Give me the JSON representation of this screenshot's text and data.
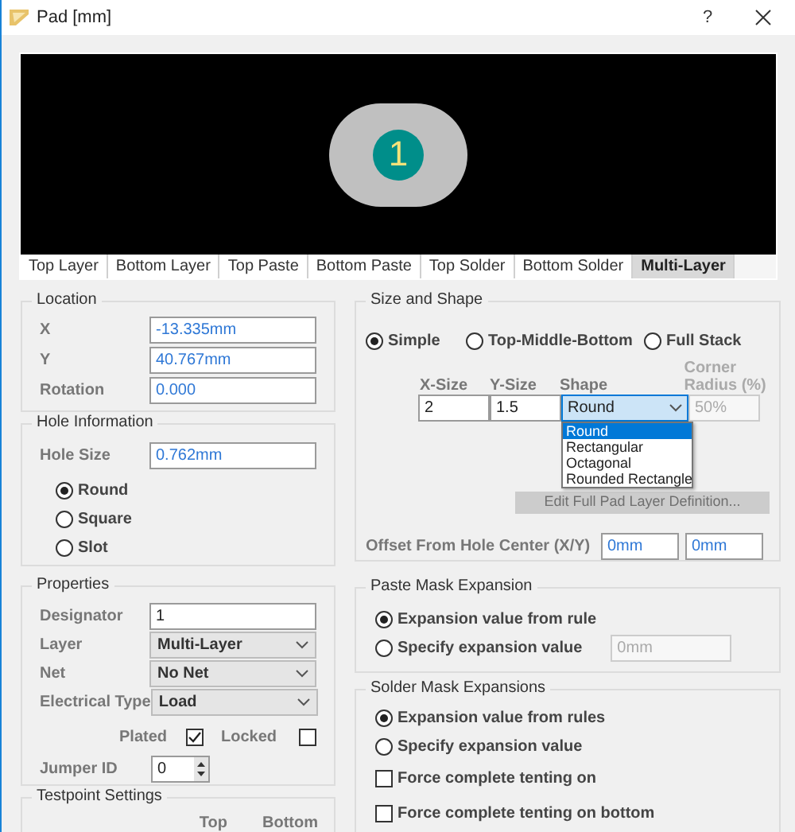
{
  "window": {
    "title": "Pad [mm]",
    "help": "?"
  },
  "preview": {
    "designator": "1"
  },
  "layer_tabs": [
    {
      "label": "Top Layer",
      "selected": false
    },
    {
      "label": "Bottom Layer",
      "selected": false
    },
    {
      "label": "Top Paste",
      "selected": false
    },
    {
      "label": "Bottom Paste",
      "selected": false
    },
    {
      "label": "Top Solder",
      "selected": false
    },
    {
      "label": "Bottom Solder",
      "selected": false
    },
    {
      "label": "Multi-Layer",
      "selected": true
    }
  ],
  "location": {
    "title": "Location",
    "fields": [
      {
        "label": "X",
        "value": "-13.335mm"
      },
      {
        "label": "Y",
        "value": "40.767mm"
      },
      {
        "label": "Rotation",
        "value": "0.000"
      }
    ]
  },
  "hole_information": {
    "title": "Hole Information",
    "hole_size": {
      "label": "Hole Size",
      "value": "0.762mm"
    },
    "shapes": [
      {
        "label": "Round",
        "selected": true
      },
      {
        "label": "Square",
        "selected": false
      },
      {
        "label": "Slot",
        "selected": false
      }
    ]
  },
  "properties": {
    "title": "Properties",
    "fields": [
      {
        "kind": "text",
        "label": "Designator",
        "value": "1"
      },
      {
        "kind": "dropdown",
        "label": "Layer",
        "value": "Multi-Layer"
      },
      {
        "kind": "dropdown",
        "label": "Net",
        "value": "No Net"
      },
      {
        "kind": "dropdown",
        "label": "Electrical Type",
        "value": "Load"
      }
    ],
    "plated": {
      "label": "Plated",
      "checked": true
    },
    "locked": {
      "label": "Locked",
      "checked": false
    },
    "jumper_id": {
      "label": "Jumper ID",
      "value": "0"
    }
  },
  "testpoint_settings": {
    "title": "Testpoint Settings",
    "columns": [
      "Top",
      "Bottom"
    ]
  },
  "size_and_shape": {
    "title": "Size and Shape",
    "modes": [
      {
        "label": "Simple",
        "selected": true
      },
      {
        "label": "Top-Middle-Bottom",
        "selected": false
      },
      {
        "label": "Full Stack",
        "selected": false
      }
    ],
    "columns": [
      "X-Size",
      "Y-Size",
      "Shape",
      "Corner Radius (%)"
    ],
    "x_size": "2",
    "y_size": "1.5",
    "shape": "Round",
    "corner_radius": {
      "value": "50%",
      "disabled": true
    },
    "shape_options": [
      {
        "label": "Round",
        "selected": true
      },
      {
        "label": "Rectangular",
        "selected": false
      },
      {
        "label": "Octagonal",
        "selected": false
      },
      {
        "label": "Rounded Rectangle",
        "selected": false
      }
    ],
    "edit_button": {
      "label": "Edit Full Pad Layer Definition...",
      "disabled": true
    },
    "offset": {
      "label": "Offset From Hole Center (X/Y)",
      "x": "0mm",
      "y": "0mm"
    }
  },
  "paste_mask": {
    "title": "Paste Mask Expansion",
    "options": [
      {
        "label": "Expansion value from rule",
        "selected": true
      },
      {
        "label": "Specify expansion value",
        "selected": false
      }
    ],
    "value": {
      "value": "0mm",
      "disabled": true
    }
  },
  "solder_mask": {
    "title": "Solder Mask Expansions",
    "options": [
      {
        "label": "Expansion value from rules",
        "selected": true
      },
      {
        "label": "Specify expansion value",
        "selected": false
      }
    ],
    "tenting": [
      {
        "label": "Force complete tenting on",
        "checked": false
      },
      {
        "label": "Force complete tenting on bottom",
        "checked": false
      }
    ]
  }
}
